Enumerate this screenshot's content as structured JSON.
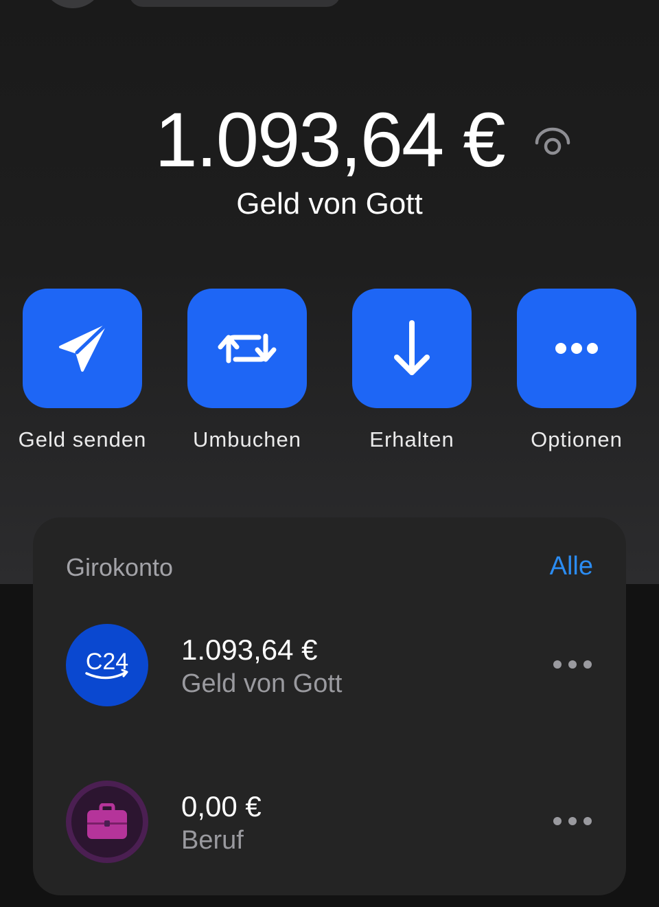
{
  "balance": {
    "amount": "1.093,64 €",
    "account_name": "Geld von Gott"
  },
  "actions": [
    {
      "label": "Geld senden",
      "icon": "paper-plane-icon"
    },
    {
      "label": "Umbuchen",
      "icon": "transfer-arrows-icon"
    },
    {
      "label": "Erhalten",
      "icon": "arrow-down-icon"
    },
    {
      "label": "Optionen",
      "icon": "more-dots-icon"
    }
  ],
  "card": {
    "title": "Girokonto",
    "all_link": "Alle",
    "accounts": [
      {
        "logo_text": "C24",
        "amount": "1.093,64 €",
        "name": "Geld von Gott",
        "logo_color": "#0a48d0"
      },
      {
        "amount": "0,00 €",
        "name": "Beruf",
        "icon": "briefcase-icon",
        "logo_color": "#4b1f52",
        "icon_color": "#b5349a"
      }
    ]
  },
  "colors": {
    "accent": "#1e66f5",
    "link": "#2b8cf2",
    "card_bg": "#242424"
  }
}
